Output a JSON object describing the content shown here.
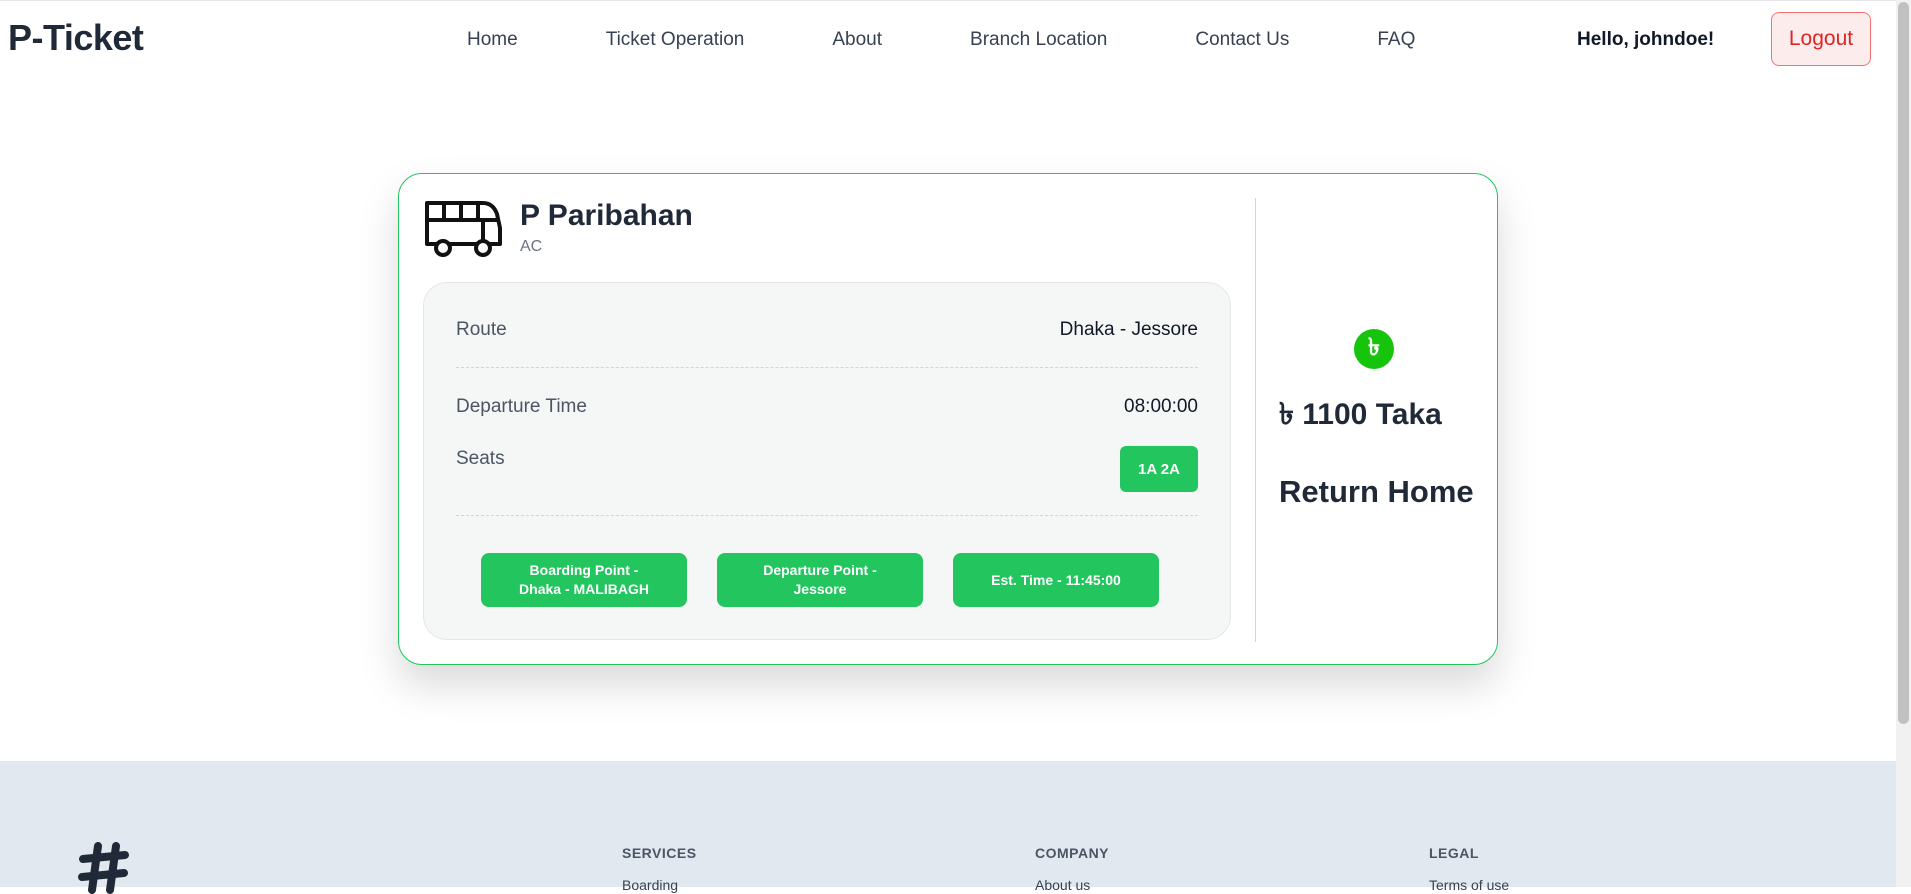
{
  "brand": {
    "logo": "P-Ticket"
  },
  "nav": {
    "links": [
      "Home",
      "Ticket Operation",
      "About",
      "Branch Location",
      "Contact Us",
      "FAQ"
    ],
    "greeting": "Hello, johndoe!",
    "logout_label": "Logout"
  },
  "ticket": {
    "operator": "P Paribahan",
    "class": "AC",
    "route_label": "Route",
    "route_value": "Dhaka - Jessore",
    "departure_label": "Departure Time",
    "departure_value": "08:00:00",
    "seats_label": "Seats",
    "seats_value": "1A 2A",
    "boarding_point": "Boarding Point -\nDhaka - MALIBAGH",
    "departure_point": "Departure Point -\nJessore",
    "est_time": "Est. Time - 11:45:00",
    "currency_icon": "taka-icon",
    "currency_symbol": "৳",
    "price": "৳ 1100 Taka",
    "return_home": "Return Home"
  },
  "footer": {
    "logo_icon": "hash-icon",
    "services_heading": "SERVICES",
    "services_link": "Boarding",
    "company_heading": "COMPANY",
    "company_link": "About us",
    "legal_heading": "LEGAL",
    "legal_link": "Terms of use"
  },
  "colors": {
    "accent": "#22c55e",
    "danger": "#dc2626",
    "footer_bg": "#e2e8f0"
  }
}
